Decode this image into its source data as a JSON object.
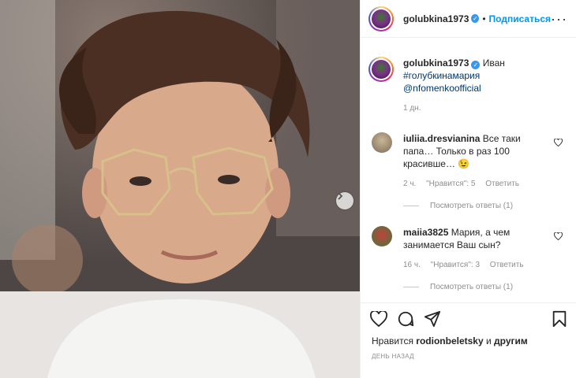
{
  "post_header": {
    "username": "golubkina1973",
    "separator": "•",
    "follow_label": "Подписаться",
    "more_label": "···"
  },
  "caption": {
    "username": "golubkina1973",
    "text": "Иван",
    "hashtag": "#голубкинамария",
    "mention": "@nfomenkoofficial",
    "time": "1 дн."
  },
  "comments": [
    {
      "username": "iuliia.dresvianina",
      "text": "Все таки папа… Только в раз 100 красивше… 😉",
      "time": "2 ч.",
      "likes": "\"Нравится\": 5",
      "reply_label": "Ответить",
      "view_replies": "Посмотреть ответы (1)"
    },
    {
      "username": "maiia3825",
      "text": "Мария, а чем занимается Ваш сын?",
      "time": "16 ч.",
      "likes": "\"Нравится\": 3",
      "reply_label": "Ответить",
      "view_replies": "Посмотреть ответы (1)"
    }
  ],
  "likes": {
    "prefix": "Нравится",
    "user": "rodionbeletsky",
    "connector": "и",
    "others": "другим"
  },
  "date_label": "ДЕНЬ НАЗАД",
  "icons": [
    "verified-badge-icon",
    "more-options-icon",
    "heart-icon",
    "comment-icon",
    "share-icon",
    "bookmark-icon",
    "next-arrow-icon"
  ],
  "colors": {
    "link_blue": "#0095f6",
    "tag_blue": "#00376b",
    "muted": "#8e8e8e",
    "text": "#262626"
  }
}
